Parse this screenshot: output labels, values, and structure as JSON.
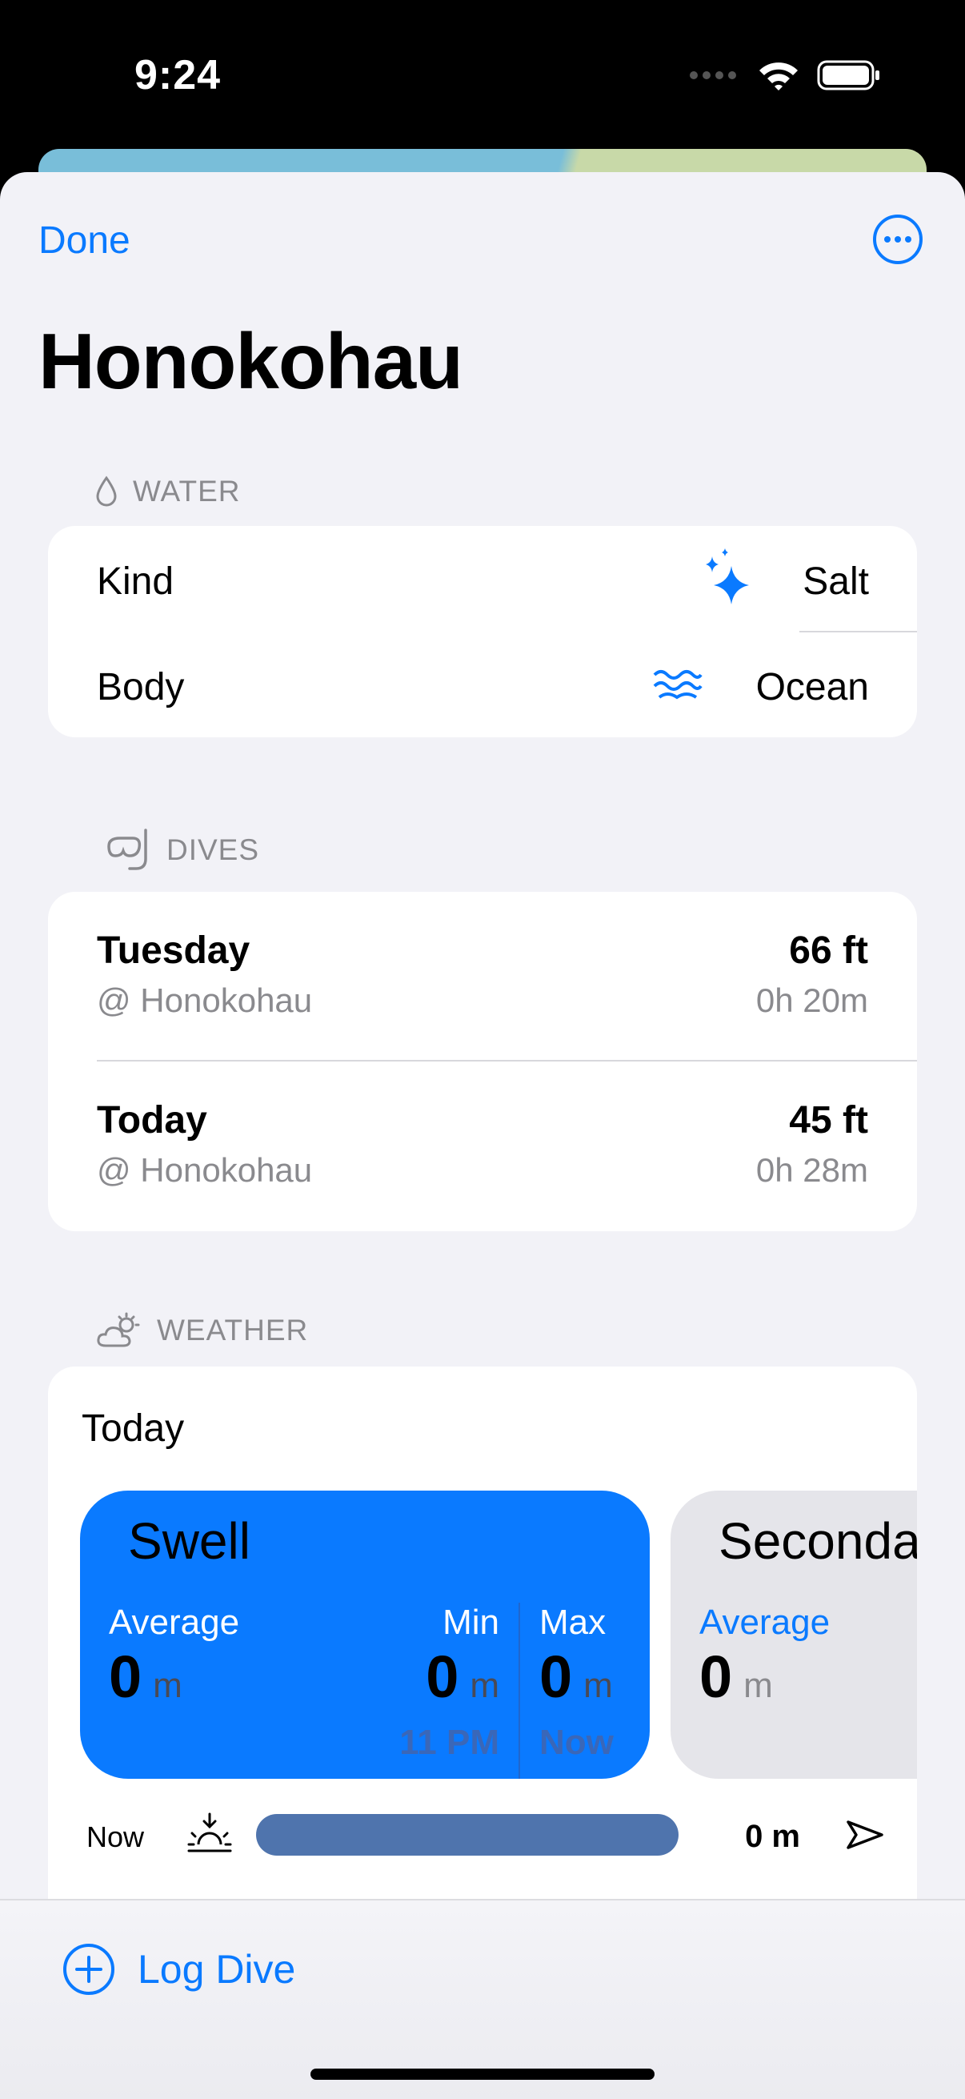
{
  "status_bar": {
    "time": "9:24"
  },
  "nav": {
    "done_label": "Done",
    "more_icon": "ellipsis-circle-icon"
  },
  "page": {
    "title": "Honokohau"
  },
  "water": {
    "header": "WATER",
    "rows": [
      {
        "label": "Kind",
        "value": "Salt",
        "icon": "sparkles-icon"
      },
      {
        "label": "Body",
        "value": "Ocean",
        "icon": "water-waves-icon"
      }
    ]
  },
  "dives": {
    "header": "DIVES",
    "items": [
      {
        "day": "Tuesday",
        "location": "@ Honokohau",
        "depth": "66 ft",
        "duration": "0h 20m"
      },
      {
        "day": "Today",
        "location": "@ Honokohau",
        "depth": "45 ft",
        "duration": "0h 28m"
      }
    ]
  },
  "weather": {
    "header": "WEATHER",
    "day_label": "Today",
    "swell": {
      "title": "Swell",
      "average_label": "Average",
      "average_value": "0",
      "average_unit": "m",
      "min_label": "Min",
      "min_value": "0",
      "min_unit": "m",
      "min_time": "11 PM",
      "max_label": "Max",
      "max_value": "0",
      "max_unit": "m",
      "max_time": "Now"
    },
    "secondary": {
      "title": "Seconda",
      "average_label": "Average",
      "average_value": "0",
      "average_unit": "m"
    },
    "now_row": {
      "label": "Now",
      "value": "0 m"
    }
  },
  "bottom": {
    "log_dive_label": "Log Dive"
  },
  "colors": {
    "accent": "#0a7aff",
    "swell_tile": "#0a7aff",
    "bar": "#4f74ad"
  }
}
